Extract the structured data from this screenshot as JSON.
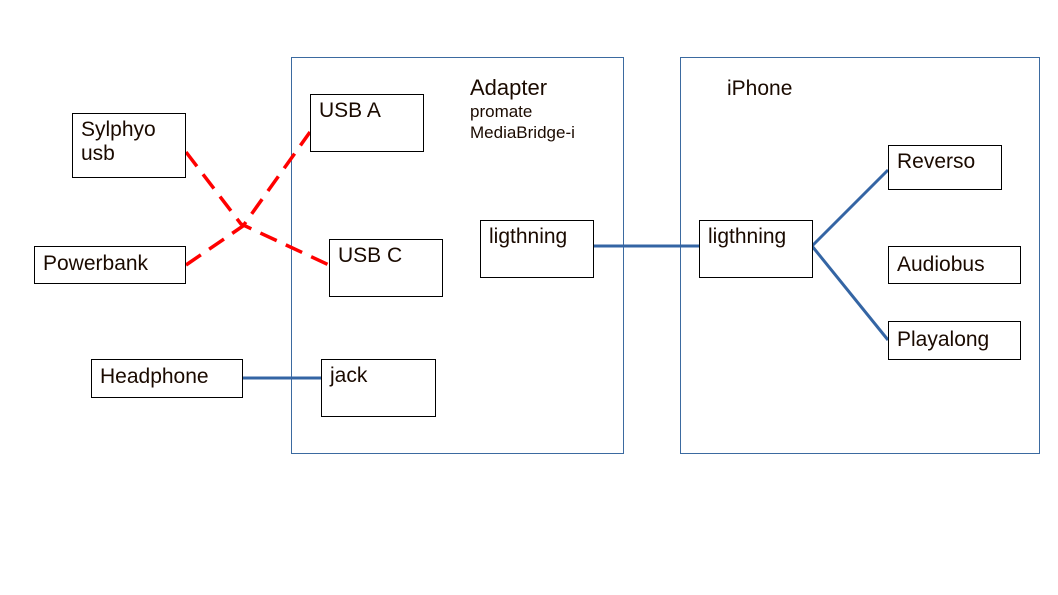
{
  "colors": {
    "container_border": "#3b6aa0",
    "blue_link": "#3465a4",
    "red_link": "#ff0000"
  },
  "adapter": {
    "title": "Adapter",
    "subtitle_line1": "promate",
    "subtitle_line2": "MediaBridge-i",
    "ports": {
      "usb_a": "USB A",
      "usb_c": "USB C",
      "jack": "jack",
      "lightning": "ligthning"
    }
  },
  "iphone": {
    "title": "iPhone",
    "lightning": "ligthning",
    "apps": {
      "reverso": "Reverso",
      "audiobus": "Audiobus",
      "playalong": "Playalong"
    }
  },
  "external": {
    "sylphyo_line1": "Sylphyo",
    "sylphyo_line2": "usb",
    "powerbank": "Powerbank",
    "headphone": "Headphone"
  }
}
